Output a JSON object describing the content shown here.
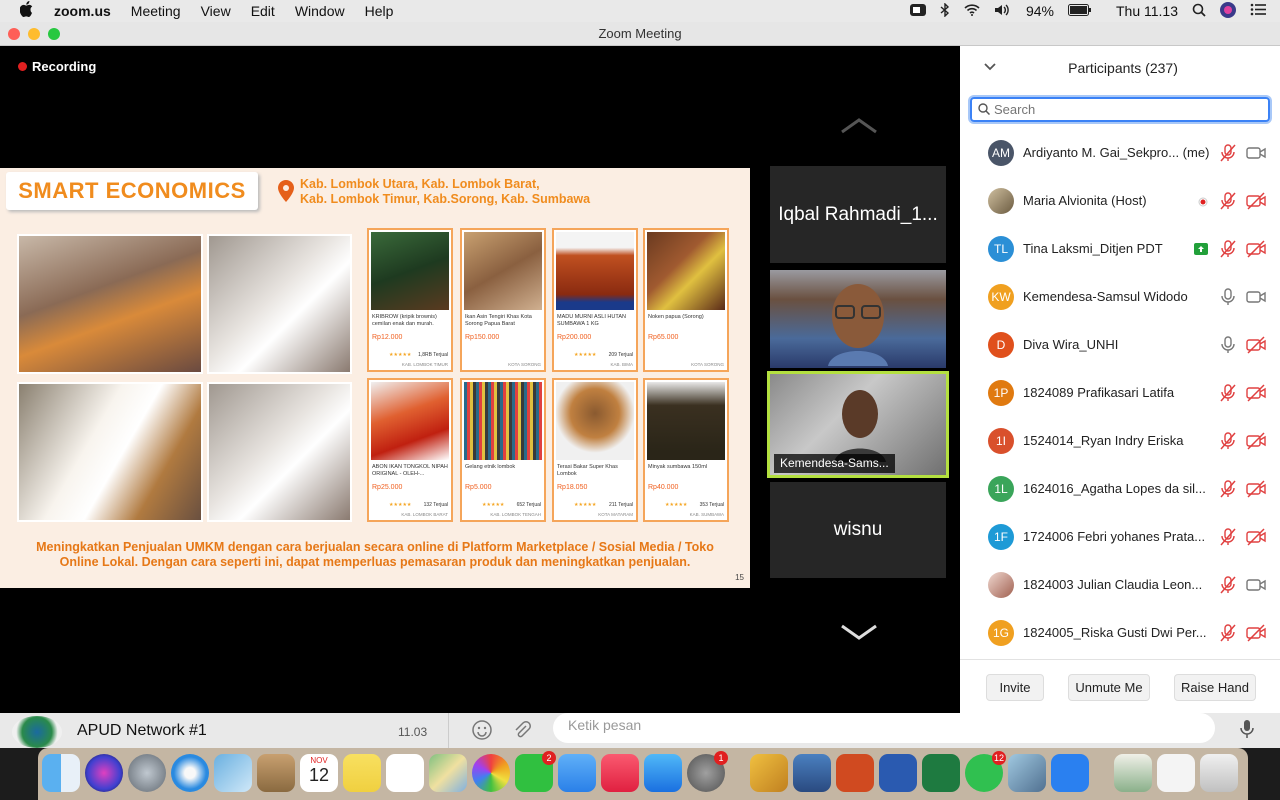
{
  "menubar": {
    "app_name": "zoom.us",
    "items": [
      "Meeting",
      "View",
      "Edit",
      "Window",
      "Help"
    ],
    "battery": "94%",
    "clock": "Thu 11.13"
  },
  "window": {
    "title": "Zoom Meeting"
  },
  "stage": {
    "recording_label": "Recording",
    "tiles": [
      {
        "name": "Iqbal Rahmadi_1..."
      },
      {
        "name": ""
      },
      {
        "name": "Kemendesa-Sams..."
      },
      {
        "name": "wisnu"
      }
    ]
  },
  "slide": {
    "title": "SMART ECONOMICS",
    "location_line1": "Kab. Lombok Utara, Kab. Lombok Barat,",
    "location_line2": "Kab. Lombok Timur, Kab.Sorong, Kab. Sumbawa",
    "products": [
      {
        "name": "KRIBROW (kripik brownis) cemilan enak dan murah.",
        "price": "Rp12.000",
        "sold": "1,8RB Terjual",
        "loc": "KAB. LOMBOK TIMUR"
      },
      {
        "name": "Ikan Asin Tengiri Khas Kota Sorong Papua Barat",
        "price": "Rp150.000",
        "sold": "",
        "loc": "KOTA SORONG"
      },
      {
        "name": "MADU MURNI ASLI HUTAN SUMBAWA 1 KG",
        "price": "Rp200.000",
        "sold": "209 Terjual",
        "loc": "KAB. BIMA"
      },
      {
        "name": "Noken papua (Sorong)",
        "price": "Rp65.000",
        "sold": "",
        "loc": "KOTA SORONG"
      },
      {
        "name": "ABON IKAN TONGKOL NIPAH ORIGINAL - OLEH-...",
        "price": "Rp25.000",
        "sold": "132 Terjual",
        "loc": "KAB. LOMBOK BARAT"
      },
      {
        "name": "Gelang etnik lombok",
        "price": "Rp5.000",
        "sold": "652 Terjual",
        "loc": "KAB. LOMBOK TENGAH"
      },
      {
        "name": "Terasi Bakar Super Khas Lombok",
        "price": "Rp18.050",
        "sold": "211 Terjual",
        "loc": "KOTA MATARAM"
      },
      {
        "name": "Minyak sumbawa 150ml",
        "price": "Rp40.000",
        "sold": "353 Terjual",
        "loc": "KAB. SUMBAWA"
      }
    ],
    "footer_line1": "Meningkatkan Penjualan UMKM dengan cara berjualan secara online di Platform Marketplace / Sosial Media / Toko",
    "footer_line2": "Online Lokal. Dengan cara seperti ini, dapat memperluas pemasaran produk dan meningkatkan penjualan.",
    "page_number": "15"
  },
  "participants": {
    "title": "Participants (237)",
    "search_placeholder": "Search",
    "list": [
      {
        "initials": "AM",
        "name": "Ardiyanto M. Gai_Sekpro... (me)",
        "color": "#4a5568"
      },
      {
        "initials": "",
        "name": "Maria Alvionita (Host)",
        "color": "#8a7a60"
      },
      {
        "initials": "TL",
        "name": "Tina Laksmi_Ditjen PDT",
        "color": "#2b8fd6"
      },
      {
        "initials": "KW",
        "name": "Kemendesa-Samsul Widodo",
        "color": "#f0a020"
      },
      {
        "initials": "D",
        "name": "Diva Wira_UNHI",
        "color": "#e0501c"
      },
      {
        "initials": "1P",
        "name": " 1824089 Prafikasari Latifa",
        "color": "#e07a10"
      },
      {
        "initials": "1I",
        "name": "1524014_Ryan Indry Eriska",
        "color": "#d9502c"
      },
      {
        "initials": "1L",
        "name": "1624016_Agatha Lopes da sil...",
        "color": "#3aa55a"
      },
      {
        "initials": "1F",
        "name": "1724006 Febri yohanes Prata...",
        "color": "#1e9ad6"
      },
      {
        "initials": "",
        "name": "1824003 Julian Claudia Leon...",
        "color": "#c9a090"
      },
      {
        "initials": "1G",
        "name": "1824005_Riska Gusti Dwi Per...",
        "color": "#f0a020"
      }
    ],
    "buttons": [
      "Invite",
      "Unmute Me",
      "Raise Hand"
    ]
  },
  "chat": {
    "network_name": "APUD Network #1",
    "network_time": "11.03",
    "message_placeholder": "Ketik pesan"
  },
  "dock": {
    "calendar_month": "NOV",
    "calendar_day": "12",
    "badges": {
      "facetime": "2",
      "sysprefs": "1",
      "whatsapp": "12"
    }
  }
}
